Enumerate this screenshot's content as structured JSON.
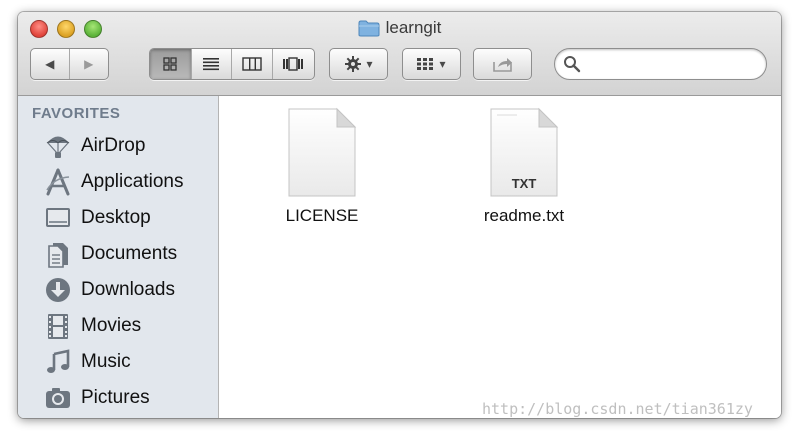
{
  "window": {
    "title": "learngit"
  },
  "toolbar": {
    "back_glyph": "◀",
    "forward_glyph": "▶",
    "views": [
      "icon-view-icon",
      "list-view-icon",
      "column-view-icon",
      "coverflow-view-icon"
    ],
    "action_caret": "▾",
    "arrange_caret": "▾",
    "search_placeholder": ""
  },
  "sidebar": {
    "section": "FAVORITES",
    "items": [
      {
        "label": "AirDrop",
        "icon": "airdrop-icon"
      },
      {
        "label": "Applications",
        "icon": "applications-icon"
      },
      {
        "label": "Desktop",
        "icon": "desktop-icon"
      },
      {
        "label": "Documents",
        "icon": "documents-icon"
      },
      {
        "label": "Downloads",
        "icon": "downloads-icon"
      },
      {
        "label": "Movies",
        "icon": "movies-icon"
      },
      {
        "label": "Music",
        "icon": "music-icon"
      },
      {
        "label": "Pictures",
        "icon": "pictures-icon"
      }
    ]
  },
  "files": [
    {
      "name": "LICENSE",
      "badge": ""
    },
    {
      "name": "readme.txt",
      "badge": "TXT"
    }
  ],
  "watermark": "http://blog.csdn.net/tian361zy",
  "colors": {
    "sidebar_bg": "#e2e7ed",
    "section_header": "#6f7c8c",
    "folder_blue": "#7fb2e0"
  }
}
